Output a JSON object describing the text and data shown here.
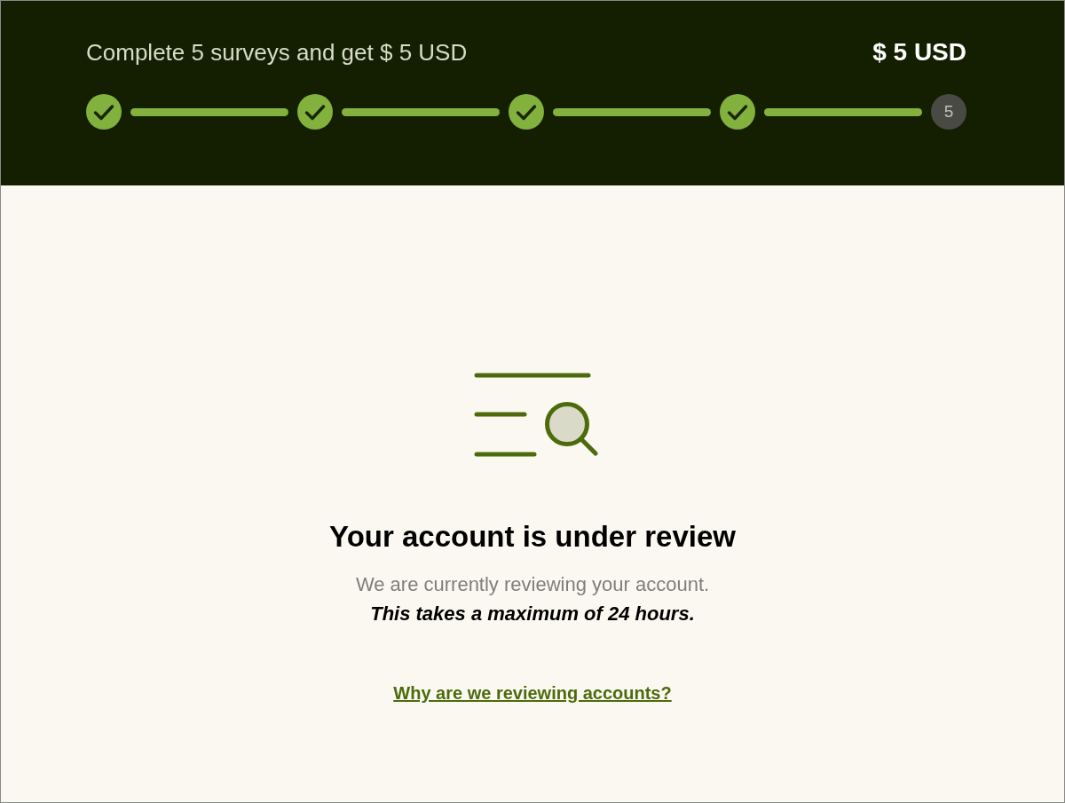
{
  "progress": {
    "title": "Complete 5 surveys and get $ 5 USD",
    "reward": "$ 5 USD",
    "steps": [
      {
        "completed": true
      },
      {
        "completed": true
      },
      {
        "completed": true
      },
      {
        "completed": true
      },
      {
        "completed": false,
        "label": "5"
      }
    ]
  },
  "review": {
    "heading": "Your account is under review",
    "message": "We are currently reviewing your account.",
    "note": "This takes a maximum of 24 hours.",
    "link": "Why are we reviewing accounts?"
  }
}
